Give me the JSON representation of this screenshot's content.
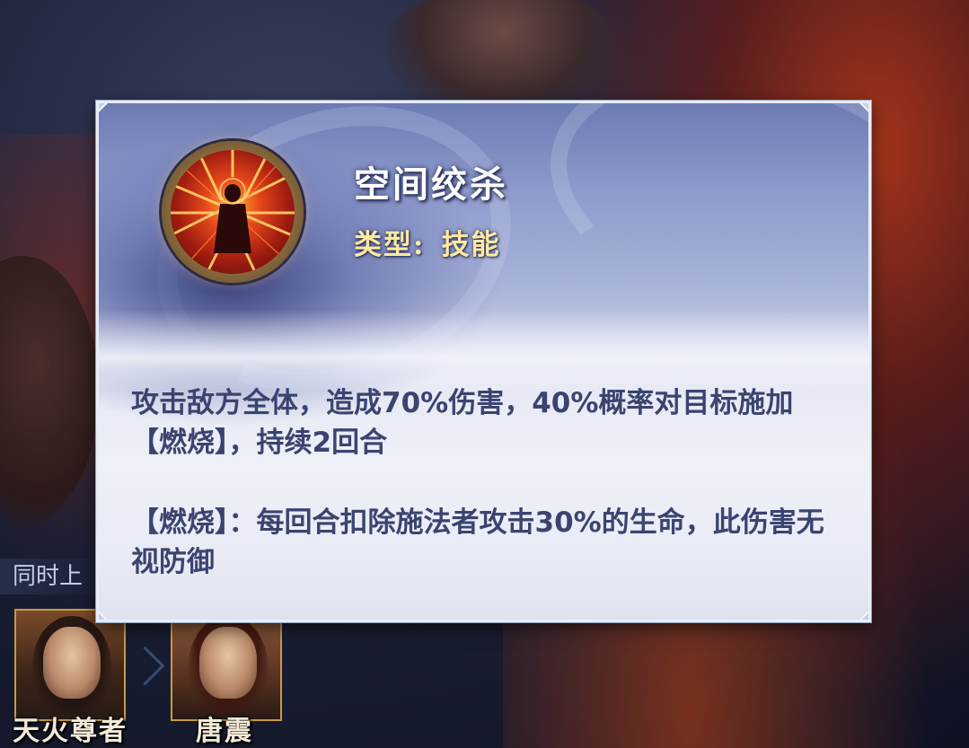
{
  "skill": {
    "name": "空间绞杀",
    "type_label": "类型:",
    "type_value": "技能",
    "icon": "red-lattice-figure-icon",
    "description": "攻击敌方全体，造成70%伤害，40%概率对目标施加【燃烧】，持续2回合",
    "effect_description": "【燃烧】：每回合扣除施法者攻击30%的生命，此伤害无视防御"
  },
  "team": {
    "label": "同时上",
    "heroes": [
      {
        "name": "天火尊者"
      },
      {
        "name": "唐震"
      }
    ]
  },
  "colors": {
    "title": "#ffffff",
    "type": "#ffe9a0",
    "description": "#3b4470",
    "panel_border": "#e9edf6",
    "card_border": "#c99a45"
  }
}
